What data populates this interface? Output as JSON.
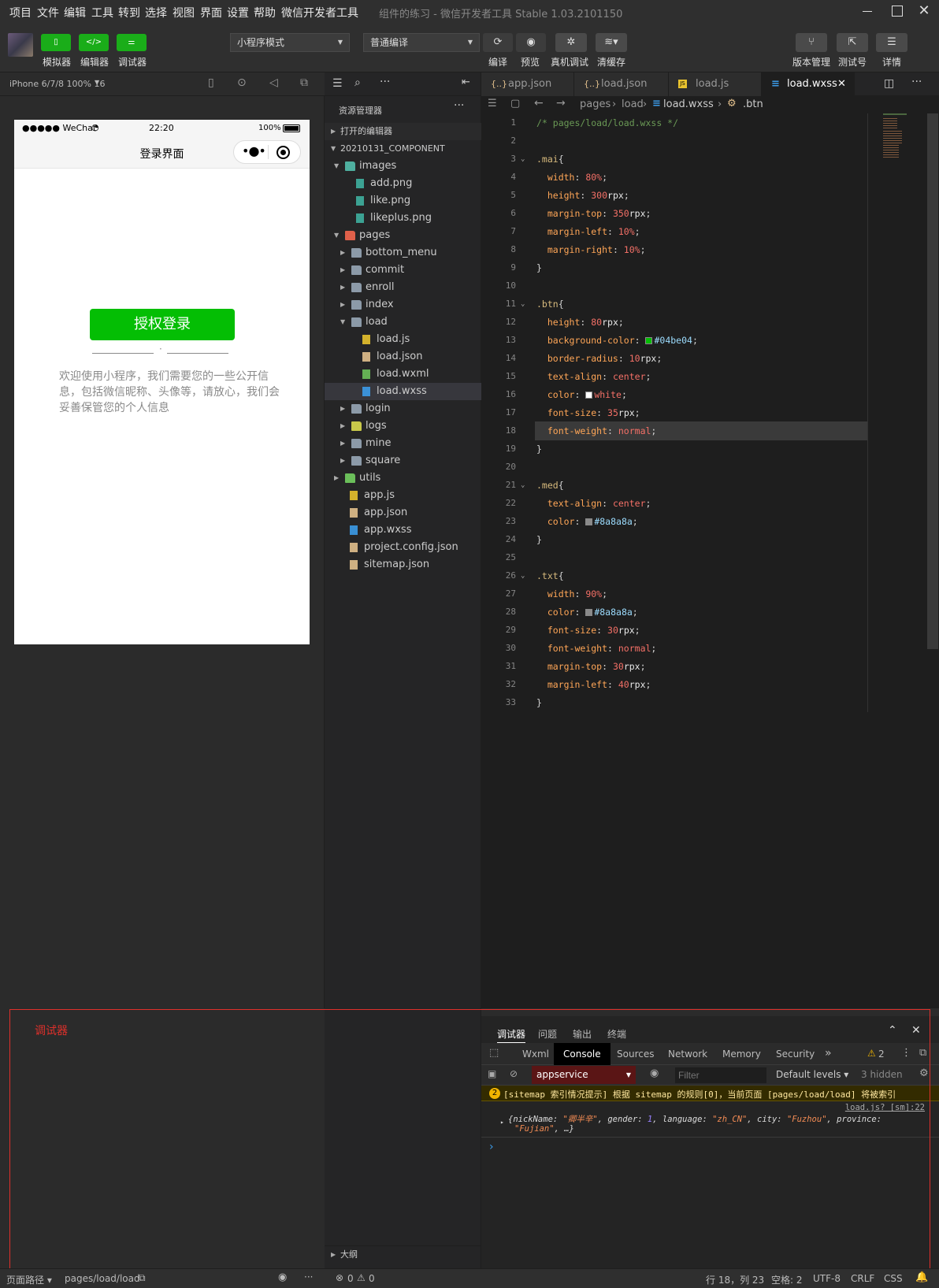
{
  "menubar": {
    "items": [
      "项目",
      "文件",
      "编辑",
      "工具",
      "转到",
      "选择",
      "视图",
      "界面",
      "设置",
      "帮助",
      "微信开发者工具"
    ],
    "title": "组件的练习 - 微信开发者工具 Stable 1.03.2101150"
  },
  "toolbar": {
    "simulator_label": "模拟器",
    "editor_label": "编辑器",
    "debugger_label": "调试器",
    "mode_select": "小程序模式",
    "compile_select": "普通编译",
    "compile_label": "编译",
    "preview_label": "预览",
    "device_debug_label": "真机调试",
    "clear_cache_label": "清缓存",
    "version_label": "版本管理",
    "test_label": "测试号",
    "detail_label": "详情"
  },
  "simulator": {
    "device": "iPhone 6/7/8 100% 16",
    "status_carrier": "●●●●● WeChat",
    "status_time": "22:20",
    "status_battery": "100%",
    "nav_title": "登录界面",
    "login_button": "授权登录",
    "divider_dot": "·",
    "info_text": "欢迎使用小程序，我们需要您的一些公开信息，包括微信昵称、头像等，请放心，我们会妥善保管您的个人信息"
  },
  "explorer": {
    "title": "资源管理器",
    "open_editors": "打开的编辑器",
    "project": "20210131_COMPONENT",
    "outline": "大纲",
    "tree": [
      {
        "label": "images",
        "depth": 1,
        "type": "folder-img",
        "open": true
      },
      {
        "label": "add.png",
        "depth": 2,
        "type": "img"
      },
      {
        "label": "like.png",
        "depth": 2,
        "type": "img"
      },
      {
        "label": "likeplus.png",
        "depth": 2,
        "type": "img"
      },
      {
        "label": "pages",
        "depth": 1,
        "type": "folder-pages",
        "open": true
      },
      {
        "label": "bottom_menu",
        "depth": 2,
        "type": "folder"
      },
      {
        "label": "commit",
        "depth": 2,
        "type": "folder"
      },
      {
        "label": "enroll",
        "depth": 2,
        "type": "folder"
      },
      {
        "label": "index",
        "depth": 2,
        "type": "folder"
      },
      {
        "label": "load",
        "depth": 2,
        "type": "folder",
        "open": true
      },
      {
        "label": "load.js",
        "depth": 3,
        "type": "js"
      },
      {
        "label": "load.json",
        "depth": 3,
        "type": "json"
      },
      {
        "label": "load.wxml",
        "depth": 3,
        "type": "wxml"
      },
      {
        "label": "load.wxss",
        "depth": 3,
        "type": "wxss",
        "selected": true
      },
      {
        "label": "login",
        "depth": 2,
        "type": "folder"
      },
      {
        "label": "logs",
        "depth": 2,
        "type": "folder-logs"
      },
      {
        "label": "mine",
        "depth": 2,
        "type": "folder"
      },
      {
        "label": "square",
        "depth": 2,
        "type": "folder"
      },
      {
        "label": "utils",
        "depth": 1,
        "type": "folder-utils"
      },
      {
        "label": "app.js",
        "depth": 1,
        "type": "js"
      },
      {
        "label": "app.json",
        "depth": 1,
        "type": "json"
      },
      {
        "label": "app.wxss",
        "depth": 1,
        "type": "wxss"
      },
      {
        "label": "project.config.json",
        "depth": 1,
        "type": "json"
      },
      {
        "label": "sitemap.json",
        "depth": 1,
        "type": "json"
      }
    ]
  },
  "tabs": [
    {
      "label": "app.json",
      "icon": "{..}"
    },
    {
      "label": "load.json",
      "icon": "{..}"
    },
    {
      "label": "load.js",
      "icon": "JS"
    },
    {
      "label": "load.wxss",
      "icon": "wxss",
      "active": true
    }
  ],
  "breadcrumb": {
    "p1": "pages",
    "p2": "load",
    "p3": "load.wxss",
    "p4": ".btn"
  },
  "code_lines": [
    [
      [
        "c-com",
        "/* pages/load/load.wxss */"
      ]
    ],
    [],
    [
      [
        "c-sel",
        ".mai"
      ],
      [
        "c-pun",
        "{"
      ]
    ],
    [
      [
        "c-prop",
        "  width"
      ],
      [
        "c-pun",
        ": "
      ],
      [
        "c-num",
        "80%"
      ],
      [
        "c-pun",
        ";"
      ]
    ],
    [
      [
        "c-prop",
        "  height"
      ],
      [
        "c-pun",
        ": "
      ],
      [
        "c-num",
        "300"
      ],
      [
        "c-unit",
        "rpx"
      ],
      [
        "c-pun",
        ";"
      ]
    ],
    [
      [
        "c-prop",
        "  margin-top"
      ],
      [
        "c-pun",
        ": "
      ],
      [
        "c-num",
        "350"
      ],
      [
        "c-unit",
        "rpx"
      ],
      [
        "c-pun",
        ";"
      ]
    ],
    [
      [
        "c-prop",
        "  margin-left"
      ],
      [
        "c-pun",
        ": "
      ],
      [
        "c-num",
        "10%"
      ],
      [
        "c-pun",
        ";"
      ]
    ],
    [
      [
        "c-prop",
        "  margin-right"
      ],
      [
        "c-pun",
        ": "
      ],
      [
        "c-num",
        "10%"
      ],
      [
        "c-pun",
        ";"
      ]
    ],
    [
      [
        "c-pun",
        "}"
      ]
    ],
    [],
    [
      [
        "c-sel",
        ".btn"
      ],
      [
        "c-pun",
        "{"
      ]
    ],
    [
      [
        "c-prop",
        "  height"
      ],
      [
        "c-pun",
        ": "
      ],
      [
        "c-num",
        "80"
      ],
      [
        "c-unit",
        "rpx"
      ],
      [
        "c-pun",
        ";"
      ]
    ],
    [
      [
        "c-prop",
        "  background-color"
      ],
      [
        "c-pun",
        ": "
      ],
      [
        "sw",
        "#04be04"
      ],
      [
        "c-hex",
        "#04be04"
      ],
      [
        "c-pun",
        ";"
      ]
    ],
    [
      [
        "c-prop",
        "  border-radius"
      ],
      [
        "c-pun",
        ": "
      ],
      [
        "c-num",
        "10"
      ],
      [
        "c-unit",
        "rpx"
      ],
      [
        "c-pun",
        ";"
      ]
    ],
    [
      [
        "c-prop",
        "  text-align"
      ],
      [
        "c-pun",
        ": "
      ],
      [
        "c-kw",
        "center"
      ],
      [
        "c-pun",
        ";"
      ]
    ],
    [
      [
        "c-prop",
        "  color"
      ],
      [
        "c-pun",
        ": "
      ],
      [
        "sw",
        "#ffffff"
      ],
      [
        "c-kw",
        "white"
      ],
      [
        "c-pun",
        ";"
      ]
    ],
    [
      [
        "c-prop",
        "  font-size"
      ],
      [
        "c-pun",
        ": "
      ],
      [
        "c-num",
        "35"
      ],
      [
        "c-unit",
        "rpx"
      ],
      [
        "c-pun",
        ";"
      ]
    ],
    [
      [
        "c-prop",
        "  font-weight"
      ],
      [
        "c-pun",
        ": "
      ],
      [
        "c-kw",
        "normal"
      ],
      [
        "c-pun",
        ";"
      ]
    ],
    [
      [
        "c-pun",
        "}"
      ]
    ],
    [],
    [
      [
        "c-sel",
        ".med"
      ],
      [
        "c-pun",
        "{"
      ]
    ],
    [
      [
        "c-prop",
        "  text-align"
      ],
      [
        "c-pun",
        ": "
      ],
      [
        "c-kw",
        "center"
      ],
      [
        "c-pun",
        ";"
      ]
    ],
    [
      [
        "c-prop",
        "  color"
      ],
      [
        "c-pun",
        ": "
      ],
      [
        "sw",
        "#8a8a8a"
      ],
      [
        "c-hex",
        "#8a8a8a"
      ],
      [
        "c-pun",
        ";"
      ]
    ],
    [
      [
        "c-pun",
        "}"
      ]
    ],
    [],
    [
      [
        "c-sel",
        ".txt"
      ],
      [
        "c-pun",
        "{"
      ]
    ],
    [
      [
        "c-prop",
        "  width"
      ],
      [
        "c-pun",
        ": "
      ],
      [
        "c-num",
        "90%"
      ],
      [
        "c-pun",
        ";"
      ]
    ],
    [
      [
        "c-prop",
        "  color"
      ],
      [
        "c-pun",
        ": "
      ],
      [
        "sw",
        "#8a8a8a"
      ],
      [
        "c-hex",
        "#8a8a8a"
      ],
      [
        "c-pun",
        ";"
      ]
    ],
    [
      [
        "c-prop",
        "  font-size"
      ],
      [
        "c-pun",
        ": "
      ],
      [
        "c-num",
        "30"
      ],
      [
        "c-unit",
        "rpx"
      ],
      [
        "c-pun",
        ";"
      ]
    ],
    [
      [
        "c-prop",
        "  font-weight"
      ],
      [
        "c-pun",
        ": "
      ],
      [
        "c-kw",
        "normal"
      ],
      [
        "c-pun",
        ";"
      ]
    ],
    [
      [
        "c-prop",
        "  margin-top"
      ],
      [
        "c-pun",
        ": "
      ],
      [
        "c-num",
        "30"
      ],
      [
        "c-unit",
        "rpx"
      ],
      [
        "c-pun",
        ";"
      ]
    ],
    [
      [
        "c-prop",
        "  margin-left"
      ],
      [
        "c-pun",
        ": "
      ],
      [
        "c-num",
        "40"
      ],
      [
        "c-unit",
        "rpx"
      ],
      [
        "c-pun",
        ";"
      ]
    ],
    [
      [
        "c-pun",
        "}"
      ]
    ]
  ],
  "current_line": 18,
  "debugger": {
    "label": "调试器",
    "top_tabs": [
      "调试器",
      "问题",
      "输出",
      "终端"
    ],
    "tabs": [
      "Wxml",
      "Console",
      "Sources",
      "Network",
      "Memory",
      "Security"
    ],
    "more": "»",
    "warn_count": "2",
    "context": "appservice",
    "filter_placeholder": "Filter",
    "levels": "Default levels ▾",
    "hidden": "3 hidden",
    "warn_badge": "2",
    "warn_text": "[sitemap 索引情况提示] 根据 sitemap 的规则[0]，当前页面 [pages/load/load] 将被索引",
    "log_source": "load.js? [sm]:22",
    "log_line1_a": "{nickName: ",
    "log_line1_b": "\"卿半辛\"",
    "log_line1_c": ", gender: ",
    "log_line1_d": "1",
    "log_line1_e": ", language: ",
    "log_line1_f": "\"zh_CN\"",
    "log_line1_g": ", city: ",
    "log_line1_h": "\"Fuzhou\"",
    "log_line1_i": ", province:",
    "log_line2_a": "\"Fujian\"",
    "log_line2_b": ", …}",
    "prompt": "›"
  },
  "statusbar": {
    "page_path_label": "页面路径 ▾",
    "page_path": "pages/load/load",
    "errors": "0",
    "warnings": "0",
    "cursor": "行 18，列 23",
    "indent": "空格: 2",
    "encoding": "UTF-8",
    "eol": "CRLF",
    "lang": "CSS"
  },
  "colors": {
    "accent": "#1aad19",
    "button_green": "#04be04",
    "annotation_red": "#e0302b"
  }
}
